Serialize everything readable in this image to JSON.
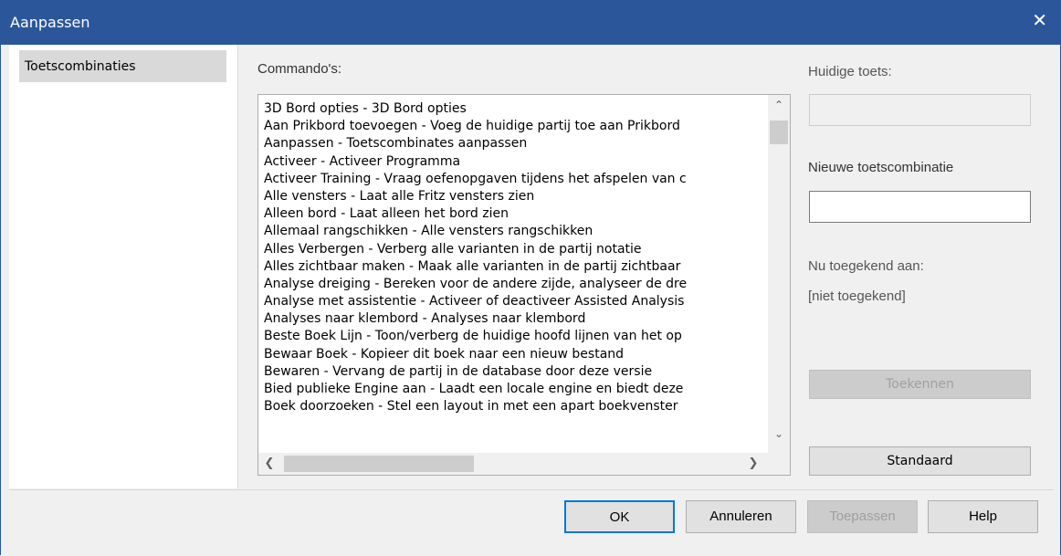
{
  "window": {
    "title": "Aanpassen",
    "close_glyph": "✕"
  },
  "nav": {
    "items": [
      {
        "label": "Toetscombinaties",
        "selected": true
      }
    ]
  },
  "commands": {
    "label": "Commando's:",
    "items": [
      "3D Bord opties - 3D Bord opties",
      "Aan Prikbord toevoegen - Voeg de huidige partij toe aan Prikbord",
      "Aanpassen - Toetscombinates aanpassen",
      "Activeer - Activeer Programma",
      "Activeer Training - Vraag oefenopgaven tijdens het afspelen van c",
      "Alle vensters - Laat alle Fritz vensters zien",
      "Alleen bord - Laat alleen het bord zien",
      "Allemaal rangschikken - Alle vensters rangschikken",
      "Alles Verbergen - Verberg alle varianten in de partij notatie",
      "Alles zichtbaar maken - Maak alle varianten in de partij zichtbaar",
      "Analyse dreiging - Bereken voor de andere zijde, analyseer de dre",
      "Analyse met assistentie - Activeer of deactiveer Assisted Analysis",
      "Analyses naar klembord - Analyses naar klembord",
      "Beste Boek Lijn - Toon/verberg de huidige hoofd lijnen van het op",
      "Bewaar Boek - Kopieer dit boek naar een nieuw bestand",
      "Bewaren - Vervang de partij in de database door deze versie",
      "Bied publieke Engine aan - Laadt een locale engine en biedt deze",
      "Boek doorzoeken - Stel een layout in met een apart boekvenster"
    ],
    "scroll_up": "⌃",
    "scroll_down": "⌄",
    "scroll_left": "❮",
    "scroll_right": "❯"
  },
  "current_key": {
    "label": "Huidige toets:",
    "value": ""
  },
  "new_key": {
    "label": "Nieuwe toetscombinatie",
    "value": ""
  },
  "assigned": {
    "label": "Nu toegekend aan:",
    "value": "[niet toegekend]"
  },
  "buttons": {
    "assign": "Toekennen",
    "default": "Standaard",
    "ok": "OK",
    "cancel": "Annuleren",
    "apply": "Toepassen",
    "help": "Help"
  },
  "colors": {
    "titlebar": "#2b579a",
    "selection": "#d9d9d9"
  }
}
